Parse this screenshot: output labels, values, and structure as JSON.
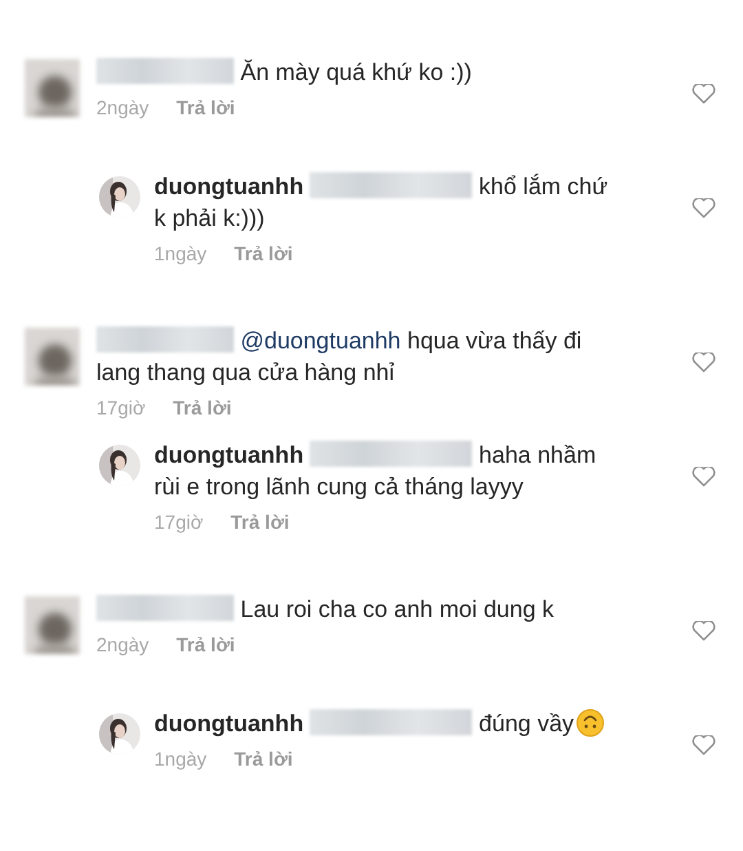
{
  "comments": [
    {
      "kind": "comment",
      "name_redacted": true,
      "text": "Ăn mày quá khứ ko :))",
      "time": "2ngày",
      "reply": "Trả lời",
      "liked": false
    },
    {
      "kind": "reply",
      "username": "duongtuanhh",
      "name_redacted": true,
      "text": "khổ lắm chứ k phải k:)))",
      "time": "1ngày",
      "reply": "Trả lời",
      "liked": false
    },
    {
      "kind": "comment",
      "name_redacted": true,
      "mention": "@duongtuanhh",
      "text": "hqua vừa thấy đi lang thang qua cửa hàng nhỉ",
      "time": "17giờ",
      "reply": "Trả lời",
      "liked": false
    },
    {
      "kind": "reply",
      "username": "duongtuanhh",
      "name_redacted": true,
      "text": "haha nhầm rùi e trong lãnh cung cả tháng layyy",
      "time": "17giờ",
      "reply": "Trả lời",
      "liked": false
    },
    {
      "kind": "comment",
      "name_redacted": true,
      "text": "Lau roi cha co anh moi dung k",
      "time": "2ngày",
      "reply": "Trả lời",
      "liked": false
    },
    {
      "kind": "reply",
      "username": "duongtuanhh",
      "name_redacted": true,
      "text": "đúng vầy",
      "emoji": true,
      "time": "1ngày",
      "reply": "Trả lời",
      "liked": false
    }
  ]
}
